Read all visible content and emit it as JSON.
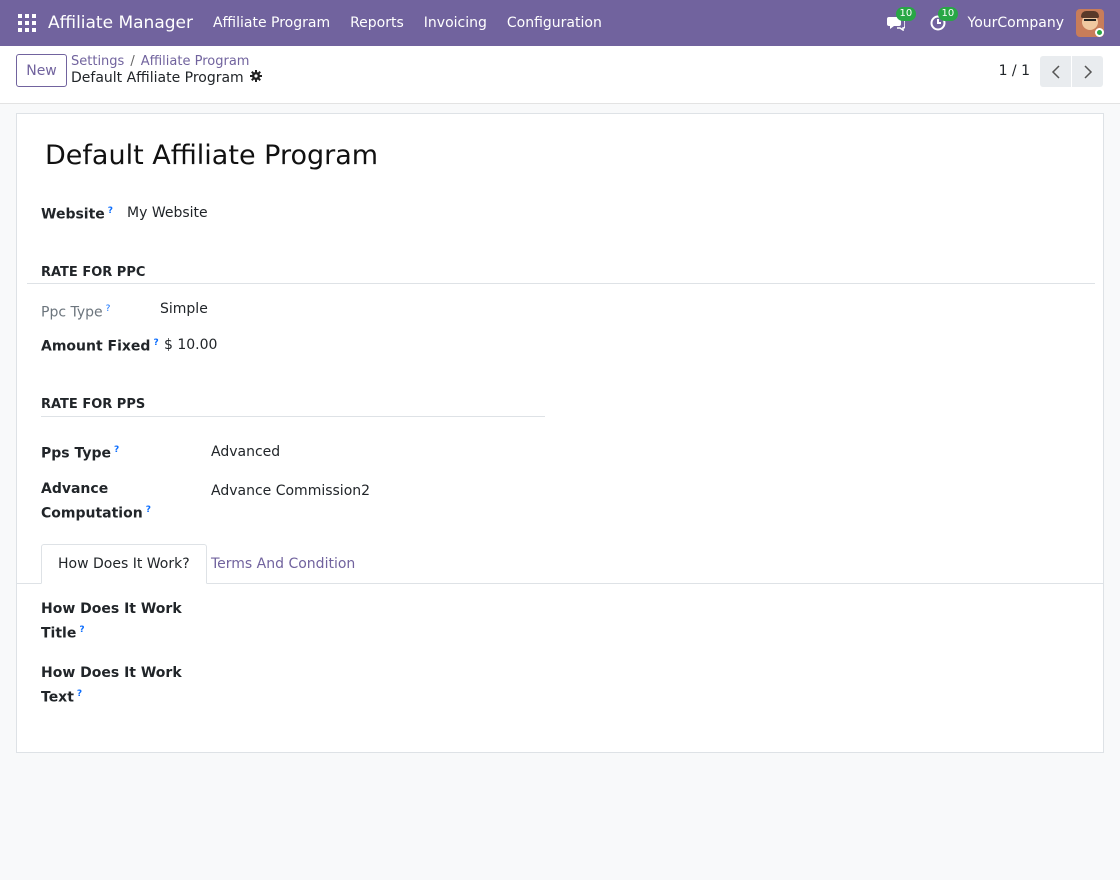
{
  "navbar": {
    "app_name": "Affiliate Manager",
    "menu": [
      "Affiliate Program",
      "Reports",
      "Invoicing",
      "Configuration"
    ],
    "messages_count": "10",
    "activities_count": "10",
    "company": "YourCompany"
  },
  "control_panel": {
    "new_label": "New",
    "breadcrumb": [
      "Settings",
      "Affiliate Program"
    ],
    "current_record": "Default Affiliate Program",
    "pager": "1 / 1"
  },
  "form": {
    "title": "Default Affiliate Program",
    "website_label": "Website",
    "website_value": "My Website",
    "ppc_section": "RATE FOR PPC",
    "ppc_type_label": "Ppc Type",
    "ppc_type_value": "Simple",
    "amount_fixed_label": "Amount Fixed",
    "amount_fixed_value": "$ 10.00",
    "pps_section": "RATE FOR PPS",
    "pps_type_label": "Pps Type",
    "pps_type_value": "Advanced",
    "advance_label_1": "Advance",
    "advance_label_2": "Computation",
    "advance_value": "Advance Commission2",
    "help_mark": "?"
  },
  "tabs": {
    "active": "How Does It Work?",
    "inactive": "Terms And Condition"
  },
  "tab_content": {
    "title_label_1": "How Does It Work",
    "title_label_2": "Title",
    "text_label_1": "How Does It Work",
    "text_label_2": "Text"
  }
}
